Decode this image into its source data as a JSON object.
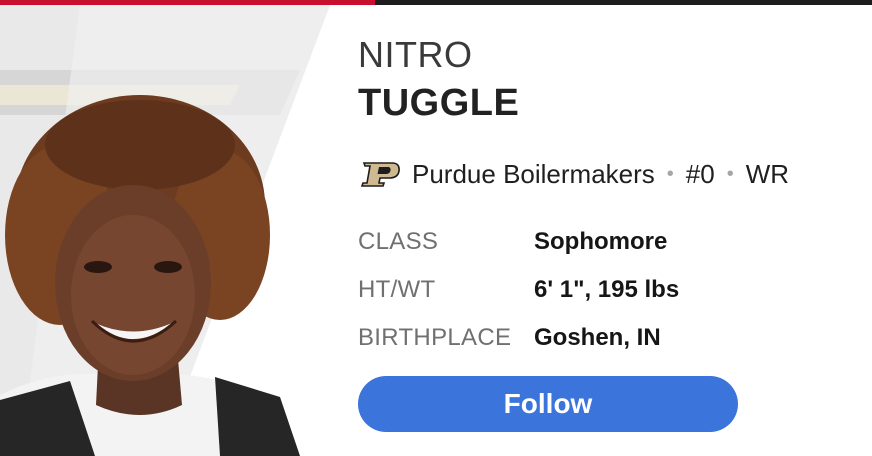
{
  "player": {
    "first_name": "NITRO",
    "last_name": "TUGGLE"
  },
  "team": {
    "name": "Purdue Boilermakers",
    "number": "#0",
    "position": "WR",
    "separator": "•",
    "logo_icon": "purdue-p-logo-icon",
    "colors": {
      "gold": "#cfb991",
      "black": "#1d1d1d"
    }
  },
  "stats": [
    {
      "label": "CLASS",
      "value": "Sophomore"
    },
    {
      "label": "HT/WT",
      "value": "6' 1\", 195 lbs"
    },
    {
      "label": "BIRTHPLACE",
      "value": "Goshen, IN"
    }
  ],
  "follow": {
    "label": "Follow",
    "color": "#3b74da"
  },
  "accent": "#c8102e"
}
